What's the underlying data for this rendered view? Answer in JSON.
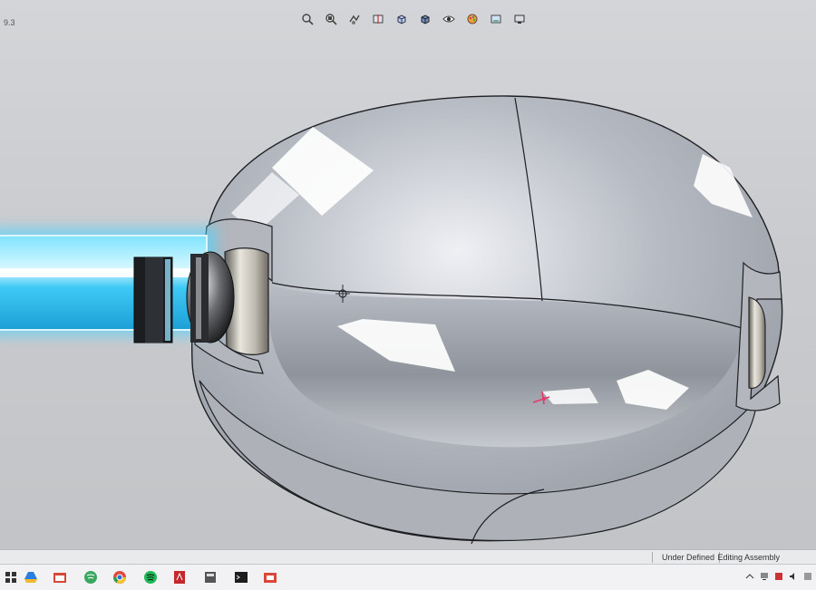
{
  "viewport": {
    "corner_label": "9.3",
    "heads_up_tools": [
      "zoom-to-fit-icon",
      "zoom-area-icon",
      "previous-view-icon",
      "section-view-icon",
      "view-orientation-icon",
      "display-style-icon",
      "hide-show-icon",
      "edit-appearance-icon",
      "apply-scene-icon",
      "view-settings-icon"
    ]
  },
  "statusbar": {
    "under_defined": "Under Defined",
    "editing": "Editing Assembly"
  },
  "taskbar": {
    "apps": [
      "start-icon",
      "drive-icon",
      "calendar-app-icon",
      "spotify-alt-icon",
      "chrome-icon",
      "spotify-icon",
      "pdf-reader-icon",
      "calculator-icon",
      "terminal-icon",
      "media-app-icon"
    ]
  },
  "colors": {
    "viewport_bg": "#c8cacd",
    "glow_cyan": "#4fd3ff",
    "body_silver": "#a9acb2"
  }
}
